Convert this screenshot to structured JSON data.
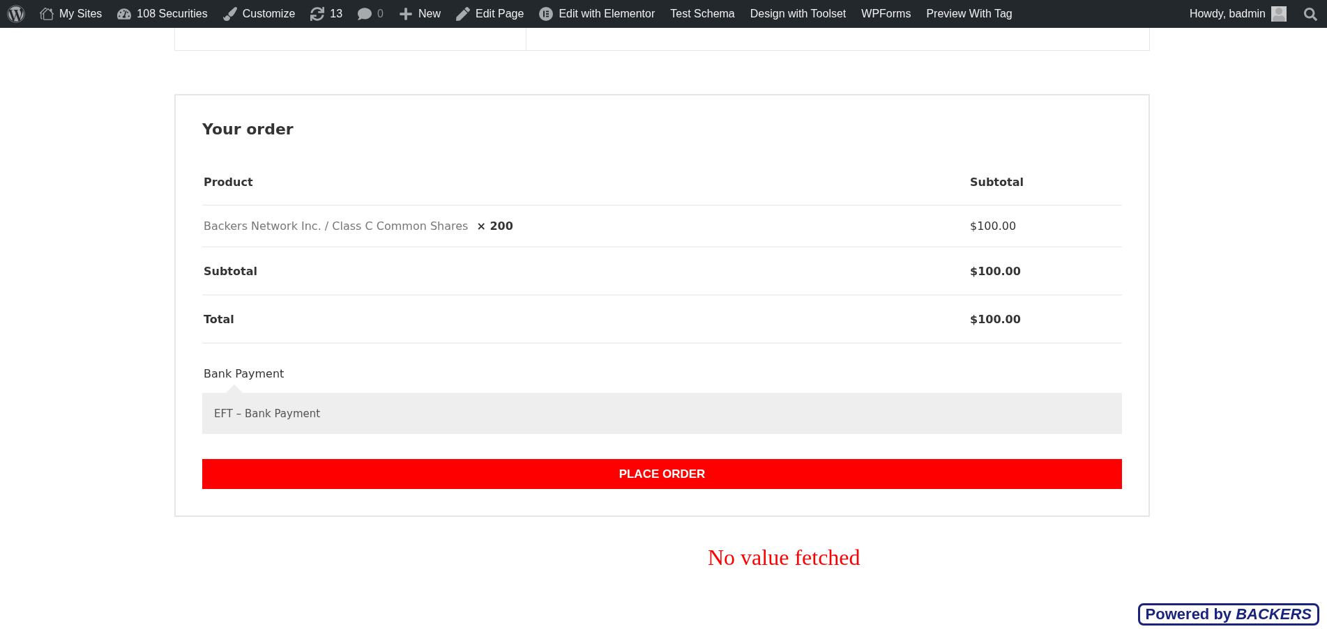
{
  "admin_bar": {
    "items": [
      {
        "label": "My Sites",
        "dimmed": false
      },
      {
        "label": "108 Securities",
        "dimmed": false
      },
      {
        "label": "Customize",
        "dimmed": false
      },
      {
        "label": "13",
        "dimmed": false
      },
      {
        "label": "0",
        "dimmed": true
      },
      {
        "label": "New",
        "dimmed": false
      },
      {
        "label": "Edit Page",
        "dimmed": false
      },
      {
        "label": "Edit with Elementor",
        "dimmed": false
      },
      {
        "label": "Test Schema",
        "dimmed": false
      },
      {
        "label": "Design with Toolset",
        "dimmed": false
      },
      {
        "label": "WPForms",
        "dimmed": false
      },
      {
        "label": "Preview With Tag",
        "dimmed": false
      }
    ],
    "account": "Howdy, badmin"
  },
  "order": {
    "title": "Your order",
    "columns": [
      "Product",
      "Subtotal"
    ],
    "items": [
      {
        "product": "Backers Network Inc. / Class C Common Shares",
        "quantity": "× 200",
        "subtotal": "$100.00"
      }
    ],
    "totals": [
      {
        "label": "Subtotal",
        "value": "$100.00"
      },
      {
        "label": "Total",
        "value": "$100.00"
      }
    ],
    "payment": {
      "method": "Bank Payment",
      "description": "EFT – Bank Payment"
    },
    "button": "PLACE ORDER"
  },
  "notice": "No value fetched",
  "badge": "Powered by *BACKERS*"
}
